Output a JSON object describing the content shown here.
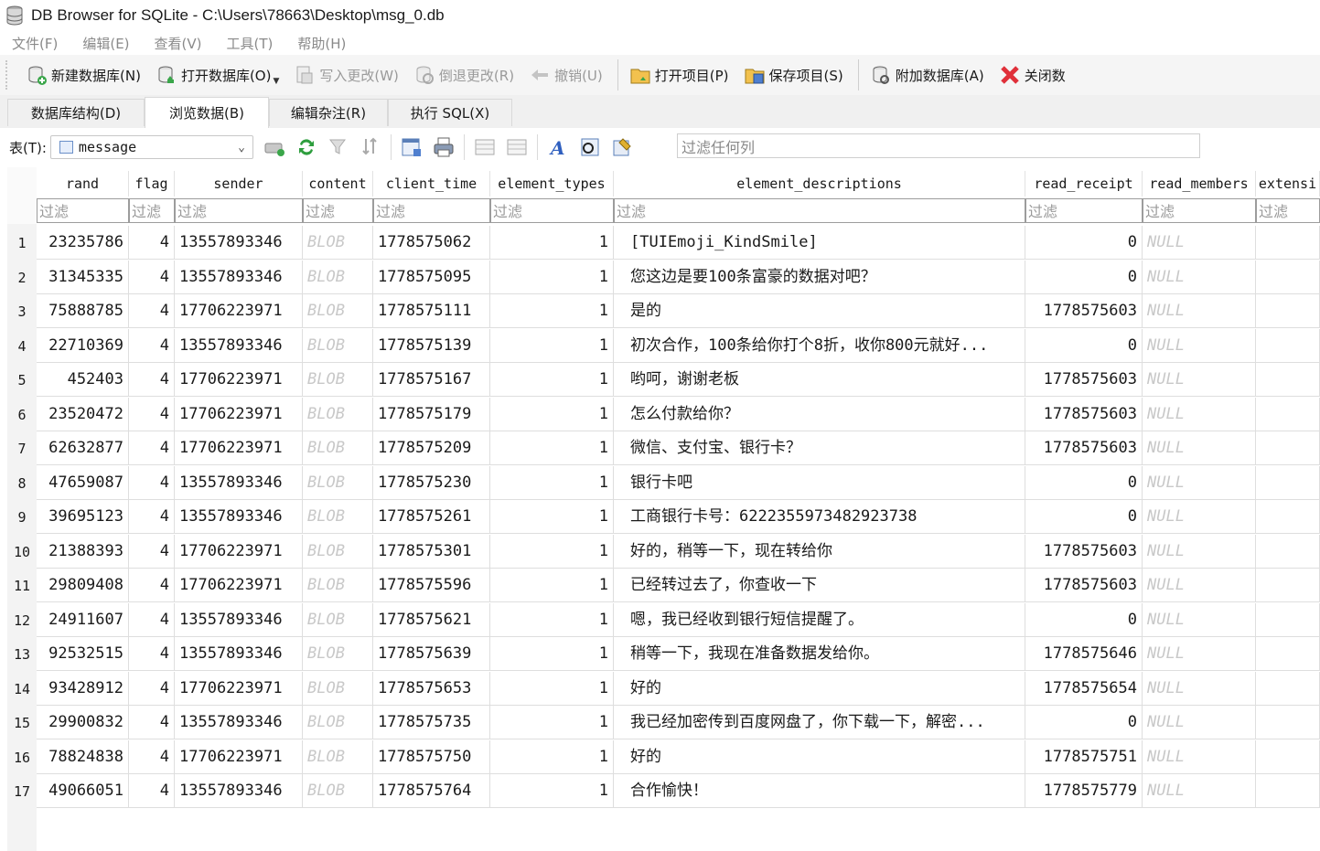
{
  "window": {
    "title": "DB Browser for SQLite - C:\\Users\\78663\\Desktop\\msg_0.db"
  },
  "menu": [
    "文件(F)",
    "编辑(E)",
    "查看(V)",
    "工具(T)",
    "帮助(H)"
  ],
  "toolbar": {
    "new_db": "新建数据库(N)",
    "open_db": "打开数据库(O)",
    "write_changes": "写入更改(W)",
    "revert_changes": "倒退更改(R)",
    "undo": "撤销(U)",
    "open_project": "打开项目(P)",
    "save_project": "保存项目(S)",
    "attach_db": "附加数据库(A)",
    "close_db": "关闭数"
  },
  "tabs": [
    "数据库结构(D)",
    "浏览数据(B)",
    "编辑杂注(R)",
    "执行 SQL(X)"
  ],
  "active_tab_index": 1,
  "browse": {
    "table_label": "表(T):",
    "table_name": "message",
    "filter_any_placeholder": "过滤任何列",
    "filter_placeholder": "过滤"
  },
  "columns": [
    "rand",
    "flag",
    "sender",
    "content",
    "client_time",
    "element_types",
    "element_descriptions",
    "read_receipt",
    "read_members",
    "extensi"
  ],
  "rows": [
    {
      "n": "1",
      "rand": "23235786",
      "flag": "4",
      "sender": "13557893346",
      "content": "BLOB",
      "client_time": "1778575062",
      "element_types": "1",
      "desc": "[TUIEmoji_KindSmile]",
      "read_receipt": "0",
      "read_members": "NULL"
    },
    {
      "n": "2",
      "rand": "31345335",
      "flag": "4",
      "sender": "13557893346",
      "content": "BLOB",
      "client_time": "1778575095",
      "element_types": "1",
      "desc": "您这边是要100条富豪的数据对吧？",
      "read_receipt": "0",
      "read_members": "NULL"
    },
    {
      "n": "3",
      "rand": "75888785",
      "flag": "4",
      "sender": "17706223971",
      "content": "BLOB",
      "client_time": "1778575111",
      "element_types": "1",
      "desc": "是的",
      "read_receipt": "1778575603",
      "read_members": "NULL"
    },
    {
      "n": "4",
      "rand": "22710369",
      "flag": "4",
      "sender": "13557893346",
      "content": "BLOB",
      "client_time": "1778575139",
      "element_types": "1",
      "desc": "初次合作，100条给你打个8折，收你800元就好...",
      "read_receipt": "0",
      "read_members": "NULL"
    },
    {
      "n": "5",
      "rand": "452403",
      "flag": "4",
      "sender": "17706223971",
      "content": "BLOB",
      "client_time": "1778575167",
      "element_types": "1",
      "desc": "哟呵，谢谢老板",
      "read_receipt": "1778575603",
      "read_members": "NULL"
    },
    {
      "n": "6",
      "rand": "23520472",
      "flag": "4",
      "sender": "17706223971",
      "content": "BLOB",
      "client_time": "1778575179",
      "element_types": "1",
      "desc": "怎么付款给你？",
      "read_receipt": "1778575603",
      "read_members": "NULL"
    },
    {
      "n": "7",
      "rand": "62632877",
      "flag": "4",
      "sender": "17706223971",
      "content": "BLOB",
      "client_time": "1778575209",
      "element_types": "1",
      "desc": "微信、支付宝、银行卡？",
      "read_receipt": "1778575603",
      "read_members": "NULL"
    },
    {
      "n": "8",
      "rand": "47659087",
      "flag": "4",
      "sender": "13557893346",
      "content": "BLOB",
      "client_time": "1778575230",
      "element_types": "1",
      "desc": "银行卡吧",
      "read_receipt": "0",
      "read_members": "NULL"
    },
    {
      "n": "9",
      "rand": "39695123",
      "flag": "4",
      "sender": "13557893346",
      "content": "BLOB",
      "client_time": "1778575261",
      "element_types": "1",
      "desc": "工商银行卡号：6222355973482923738",
      "read_receipt": "0",
      "read_members": "NULL"
    },
    {
      "n": "10",
      "rand": "21388393",
      "flag": "4",
      "sender": "17706223971",
      "content": "BLOB",
      "client_time": "1778575301",
      "element_types": "1",
      "desc": "好的，稍等一下，现在转给你",
      "read_receipt": "1778575603",
      "read_members": "NULL"
    },
    {
      "n": "11",
      "rand": "29809408",
      "flag": "4",
      "sender": "17706223971",
      "content": "BLOB",
      "client_time": "1778575596",
      "element_types": "1",
      "desc": "已经转过去了，你查收一下",
      "read_receipt": "1778575603",
      "read_members": "NULL"
    },
    {
      "n": "12",
      "rand": "24911607",
      "flag": "4",
      "sender": "13557893346",
      "content": "BLOB",
      "client_time": "1778575621",
      "element_types": "1",
      "desc": "嗯，我已经收到银行短信提醒了。",
      "read_receipt": "0",
      "read_members": "NULL"
    },
    {
      "n": "13",
      "rand": "92532515",
      "flag": "4",
      "sender": "13557893346",
      "content": "BLOB",
      "client_time": "1778575639",
      "element_types": "1",
      "desc": "稍等一下，我现在准备数据发给你。",
      "read_receipt": "1778575646",
      "read_members": "NULL"
    },
    {
      "n": "14",
      "rand": "93428912",
      "flag": "4",
      "sender": "17706223971",
      "content": "BLOB",
      "client_time": "1778575653",
      "element_types": "1",
      "desc": "好的",
      "read_receipt": "1778575654",
      "read_members": "NULL"
    },
    {
      "n": "15",
      "rand": "29900832",
      "flag": "4",
      "sender": "13557893346",
      "content": "BLOB",
      "client_time": "1778575735",
      "element_types": "1",
      "desc": "我已经加密传到百度网盘了，你下载一下，解密...",
      "read_receipt": "0",
      "read_members": "NULL"
    },
    {
      "n": "16",
      "rand": "78824838",
      "flag": "4",
      "sender": "17706223971",
      "content": "BLOB",
      "client_time": "1778575750",
      "element_types": "1",
      "desc": "好的",
      "read_receipt": "1778575751",
      "read_members": "NULL"
    },
    {
      "n": "17",
      "rand": "49066051",
      "flag": "4",
      "sender": "13557893346",
      "content": "BLOB",
      "client_time": "1778575764",
      "element_types": "1",
      "desc": "合作愉快！",
      "read_receipt": "1778575779",
      "read_members": "NULL"
    }
  ]
}
